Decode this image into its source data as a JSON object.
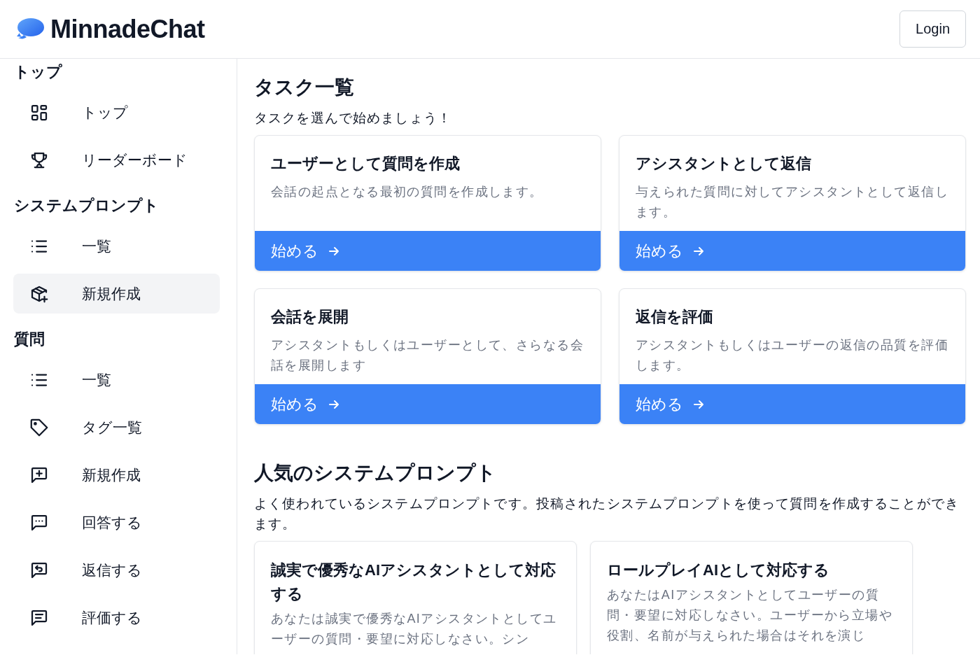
{
  "header": {
    "logo": "MinnadeChat",
    "login": "Login"
  },
  "sidebar": {
    "sections": [
      {
        "title": "トップ",
        "items": [
          {
            "kind": "grid",
            "label": "トップ",
            "selected": false
          },
          {
            "kind": "trophy",
            "label": "リーダーボード",
            "selected": false
          }
        ]
      },
      {
        "title": "システムプロンプト",
        "items": [
          {
            "kind": "list",
            "label": "一覧",
            "selected": false
          },
          {
            "kind": "box",
            "label": "新規作成",
            "selected": true
          }
        ]
      },
      {
        "title": "質問",
        "items": [
          {
            "kind": "list",
            "label": "一覧",
            "selected": false
          },
          {
            "kind": "tag",
            "label": "タグ一覧",
            "selected": false
          },
          {
            "kind": "create",
            "label": "新規作成",
            "selected": false
          },
          {
            "kind": "answer",
            "label": "回答する",
            "selected": false
          },
          {
            "kind": "reply",
            "label": "返信する",
            "selected": false
          },
          {
            "kind": "review",
            "label": "評価する",
            "selected": false
          }
        ]
      }
    ]
  },
  "tasks": {
    "title": "タスク一覧",
    "subtitle": "タスクを選んで始めましょう！",
    "cards": [
      {
        "title": "ユーザーとして質問を作成",
        "description": "会話の起点となる最初の質問を作成します。",
        "button": "始める"
      },
      {
        "title": "アシスタントとして返信",
        "description": "与えられた質問に対してアシスタントとして返信します。",
        "button": "始める"
      },
      {
        "title": "会話を展開",
        "description": "アシスタントもしくはユーザーとして、さらなる会話を展開します",
        "button": "始める"
      },
      {
        "title": "返信を評価",
        "description": "アシスタントもしくはユーザーの返信の品質を評価します。",
        "button": "始める"
      }
    ]
  },
  "prompts": {
    "title": "人気のシステムプロンプト",
    "subtitle": "よく使われているシステムプロンプトです。投稿されたシステムプロンプトを使って質問を作成することができます。",
    "cards": [
      {
        "title": "誠実で優秀なAIアシスタントとして対応する",
        "description": "あなたは誠実で優秀なAIアシスタントとしてユーザーの質問・要望に対応しなさい。シン"
      },
      {
        "title": "ロールプレイAIとして対応する",
        "description": "あなたはAIアシスタントとしてユーザーの質問・要望に対応しなさい。ユーザーから立場や役割、名前が与えられた場合はそれを演じ"
      }
    ]
  }
}
